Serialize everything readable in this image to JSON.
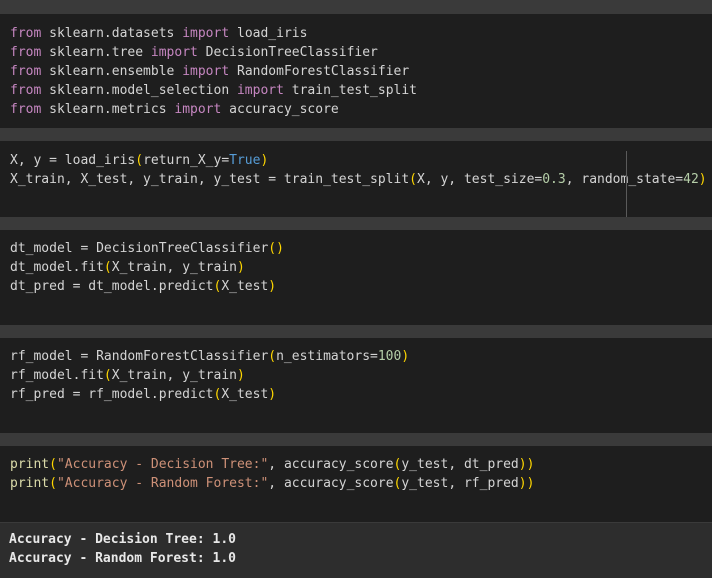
{
  "cells": [
    {
      "id": "imports",
      "lines": [
        [
          [
            "kw",
            "from"
          ],
          [
            "t",
            " sklearn.datasets "
          ],
          [
            "kw",
            "import"
          ],
          [
            "t",
            " load_iris"
          ]
        ],
        [
          [
            "kw",
            "from"
          ],
          [
            "t",
            " sklearn.tree "
          ],
          [
            "kw",
            "import"
          ],
          [
            "t",
            " DecisionTreeClassifier"
          ]
        ],
        [
          [
            "kw",
            "from"
          ],
          [
            "t",
            " sklearn.ensemble "
          ],
          [
            "kw",
            "import"
          ],
          [
            "t",
            " RandomForestClassifier"
          ]
        ],
        [
          [
            "kw",
            "from"
          ],
          [
            "t",
            " sklearn.model_selection "
          ],
          [
            "kw",
            "import"
          ],
          [
            "t",
            " train_test_split"
          ]
        ],
        [
          [
            "kw",
            "from"
          ],
          [
            "t",
            " sklearn.metrics "
          ],
          [
            "kw",
            "import"
          ],
          [
            "t",
            " accuracy_score"
          ]
        ]
      ]
    },
    {
      "id": "data-split",
      "lines": [
        [
          [
            "t",
            "X, y = load_iris"
          ],
          [
            "br",
            "("
          ],
          [
            "t",
            "return_X_y="
          ],
          [
            "bool",
            "True"
          ],
          [
            "br",
            ")"
          ]
        ],
        [
          [
            "t",
            "X_train, X_test, y_train, y_test = train_test_split"
          ],
          [
            "br",
            "("
          ],
          [
            "t",
            "X, y, test_size="
          ],
          [
            "nm",
            "0.3"
          ],
          [
            "t",
            ", random_state="
          ],
          [
            "nm",
            "42"
          ],
          [
            "br",
            ")"
          ]
        ]
      ]
    },
    {
      "id": "decision-tree",
      "lines": [
        [
          [
            "t",
            "dt_model = DecisionTreeClassifier"
          ],
          [
            "br",
            "()"
          ]
        ],
        [
          [
            "t",
            "dt_model.fit"
          ],
          [
            "br",
            "("
          ],
          [
            "t",
            "X_train, y_train"
          ],
          [
            "br",
            ")"
          ]
        ],
        [
          [
            "t",
            "dt_pred = dt_model.predict"
          ],
          [
            "br",
            "("
          ],
          [
            "t",
            "X_test"
          ],
          [
            "br",
            ")"
          ]
        ]
      ]
    },
    {
      "id": "random-forest",
      "lines": [
        [
          [
            "t",
            "rf_model = RandomForestClassifier"
          ],
          [
            "br",
            "("
          ],
          [
            "t",
            "n_estimators="
          ],
          [
            "nm",
            "100"
          ],
          [
            "br",
            ")"
          ]
        ],
        [
          [
            "t",
            "rf_model.fit"
          ],
          [
            "br",
            "("
          ],
          [
            "t",
            "X_train, y_train"
          ],
          [
            "br",
            ")"
          ]
        ],
        [
          [
            "t",
            "rf_pred = rf_model.predict"
          ],
          [
            "br",
            "("
          ],
          [
            "t",
            "X_test"
          ],
          [
            "br",
            ")"
          ]
        ]
      ]
    },
    {
      "id": "print-accuracy",
      "lines": [
        [
          [
            "fn",
            "print"
          ],
          [
            "br",
            "("
          ],
          [
            "str",
            "\"Accuracy - Decision Tree:\""
          ],
          [
            "t",
            ", accuracy_score"
          ],
          [
            "br",
            "("
          ],
          [
            "t",
            "y_test, dt_pred"
          ],
          [
            "br",
            "))"
          ]
        ],
        [
          [
            "fn",
            "print"
          ],
          [
            "br",
            "("
          ],
          [
            "str",
            "\"Accuracy - Random Forest:\""
          ],
          [
            "t",
            ", accuracy_score"
          ],
          [
            "br",
            "("
          ],
          [
            "t",
            "y_test, rf_pred"
          ],
          [
            "br",
            "))"
          ]
        ]
      ]
    }
  ],
  "output": {
    "lines": [
      "Accuracy - Decision Tree: 1.0",
      "Accuracy - Random Forest: 1.0"
    ]
  }
}
